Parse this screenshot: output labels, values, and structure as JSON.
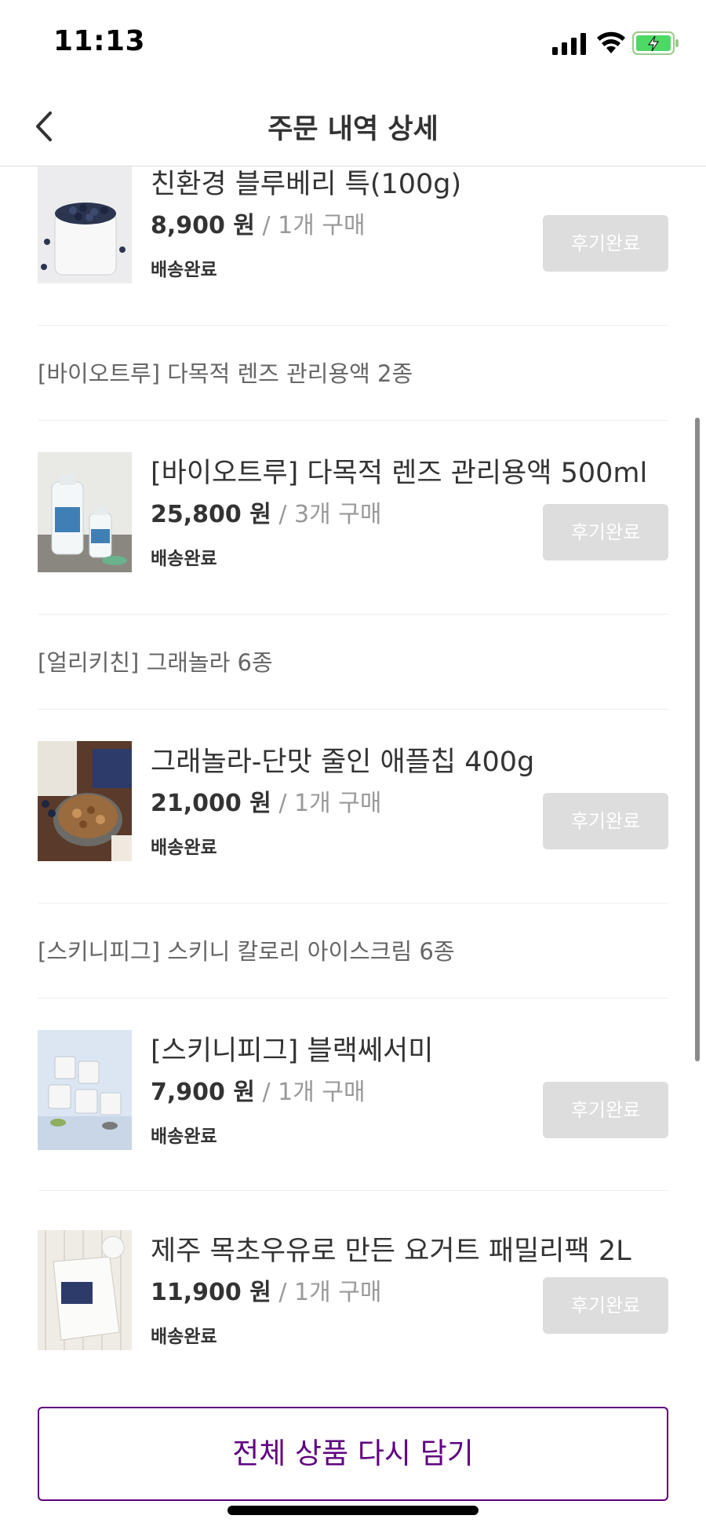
{
  "status_bar": {
    "time": "11:13"
  },
  "header": {
    "title": "주문 내역 상세",
    "back_icon": "chevron-left-icon"
  },
  "groups": [
    {
      "title": "",
      "items": [
        {
          "name": "친환경 블루베리 특(100g)",
          "price": "8,900 원",
          "qty": " / 1개 구매",
          "status": "배송완료",
          "review_label": "후기완료",
          "image": "blueberry-cup"
        }
      ]
    },
    {
      "title": "[바이오트루] 다목적 렌즈 관리용액 2종",
      "items": [
        {
          "name": "[바이오트루] 다목적 렌즈 관리용액 500ml",
          "price": "25,800 원",
          "qty": " / 3개 구매",
          "status": "배송완료",
          "review_label": "후기완료",
          "image": "lens-solution-bottles"
        }
      ]
    },
    {
      "title": "[얼리키친] 그래놀라 6종",
      "items": [
        {
          "name": "그래놀라-단맛 줄인 애플칩 400g",
          "price": "21,000 원",
          "qty": " / 1개 구매",
          "status": "배송완료",
          "review_label": "후기완료",
          "image": "granola-bowl"
        }
      ]
    },
    {
      "title": "[스키니피그] 스키니 칼로리 아이스크림 6종",
      "items": [
        {
          "name": "[스키니피그] 블랙쎄서미",
          "price": "7,900 원",
          "qty": " / 1개 구매",
          "status": "배송완료",
          "review_label": "후기완료",
          "image": "ice-cream-cups"
        },
        {
          "name": "제주 목초우유로 만든 요거트 패밀리팩 2L",
          "price": "11,900 원",
          "qty": " / 1개 구매",
          "status": "배송완료",
          "review_label": "후기완료",
          "image": "yogurt-pouch"
        }
      ]
    }
  ],
  "cta": {
    "label": "전체 상품 다시 담기"
  },
  "colors": {
    "accent": "#5f0080",
    "review_button_bg": "#dddddd",
    "qty_text": "#999999"
  }
}
